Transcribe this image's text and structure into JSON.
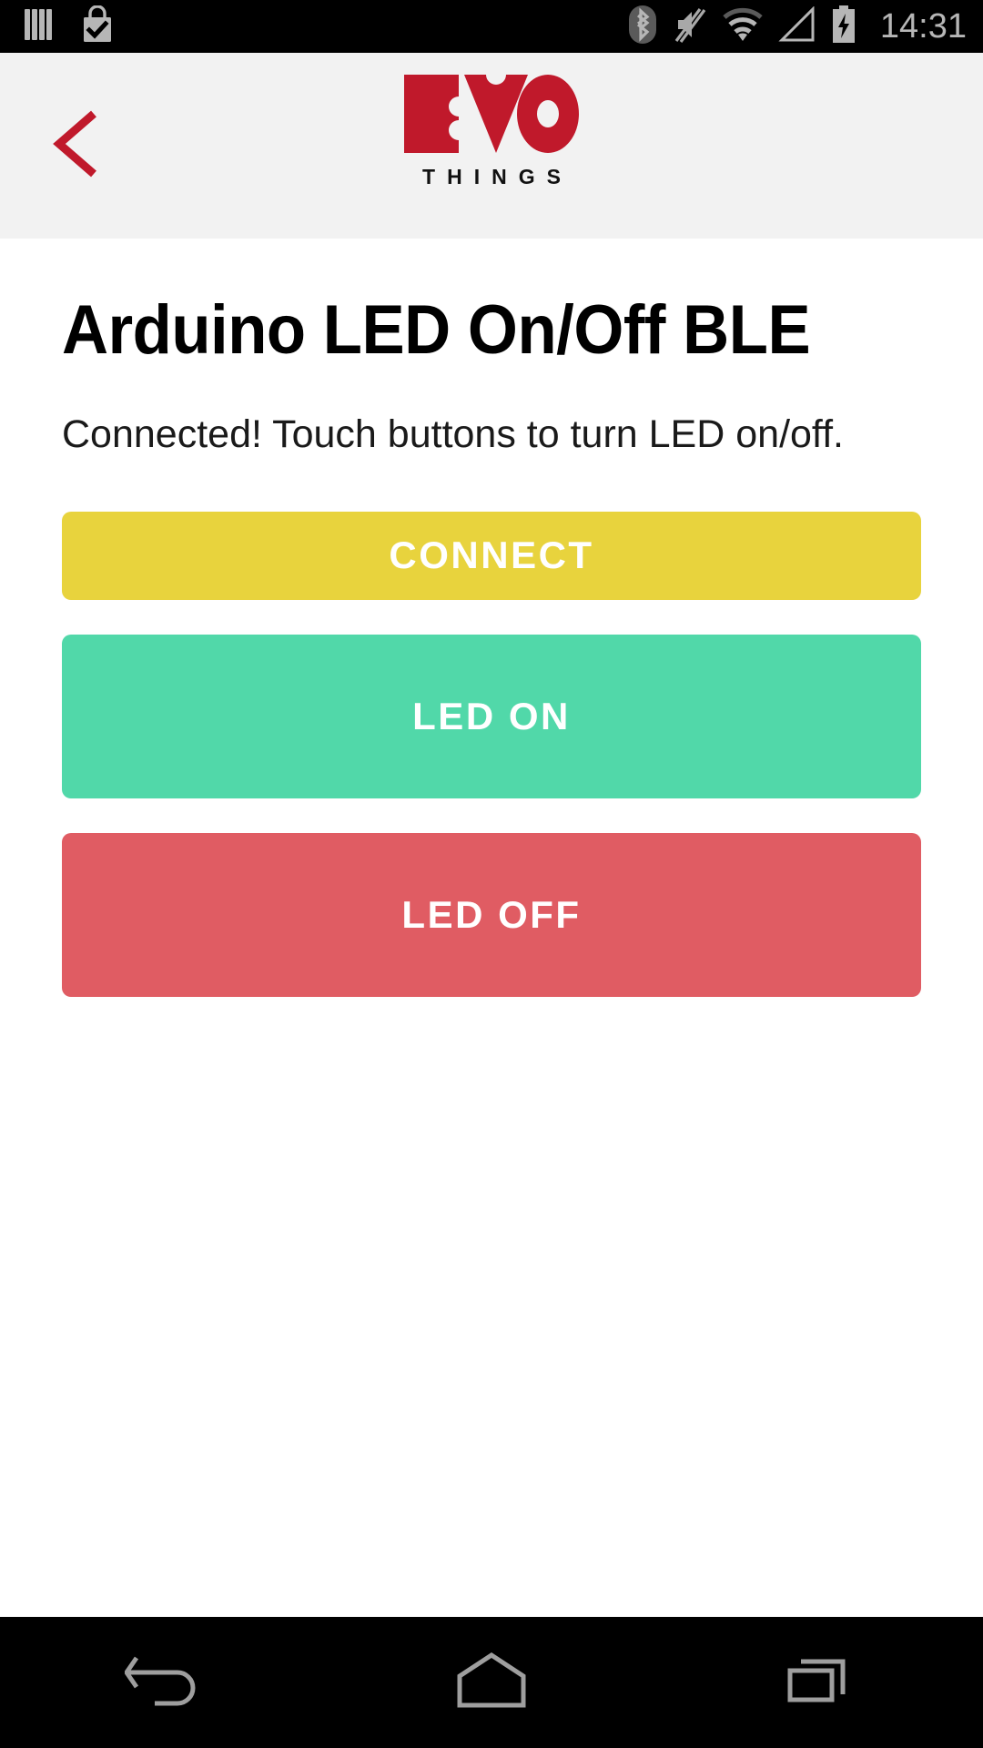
{
  "status_bar": {
    "time": "14:31",
    "left_icons": [
      {
        "name": "library-books-icon",
        "label": "Books"
      },
      {
        "name": "shopping-bag-check-icon",
        "label": "Play Store download complete"
      }
    ],
    "right_icons": [
      {
        "name": "bluetooth-icon",
        "label": "Bluetooth on"
      },
      {
        "name": "volume-mute-icon",
        "label": "Silent mode"
      },
      {
        "name": "wifi-icon",
        "label": "Wi-Fi connected"
      },
      {
        "name": "cellular-signal-icon",
        "label": "No cellular signal"
      },
      {
        "name": "battery-charging-icon",
        "label": "Battery charging"
      }
    ],
    "background_color": "#000000",
    "icon_color": "#b6b6b6"
  },
  "header": {
    "background_color": "#f2f2f2",
    "back_label": "<",
    "back_icon": "chevron-left-icon",
    "brand_mark": "EVO",
    "brand_sub": "THINGS",
    "brand_color": "#c0192b"
  },
  "main": {
    "title": "Arduino LED On/Off BLE",
    "description": "Connected! Touch buttons to turn LED on/off.",
    "buttons": [
      {
        "label": "CONNECT",
        "color": "#e8d33d",
        "name": "connect-button"
      },
      {
        "label": "LED ON",
        "color": "#51d8a9",
        "name": "led-on-button"
      },
      {
        "label": "LED OFF",
        "color": "#e05c63",
        "name": "led-off-button"
      }
    ]
  },
  "nav_bar": {
    "background_color": "#000000",
    "icon_color": "#9e9e9e",
    "items": [
      {
        "name": "nav-back-icon",
        "label": "Back"
      },
      {
        "name": "nav-home-icon",
        "label": "Home"
      },
      {
        "name": "nav-recents-icon",
        "label": "Recent apps"
      }
    ]
  }
}
